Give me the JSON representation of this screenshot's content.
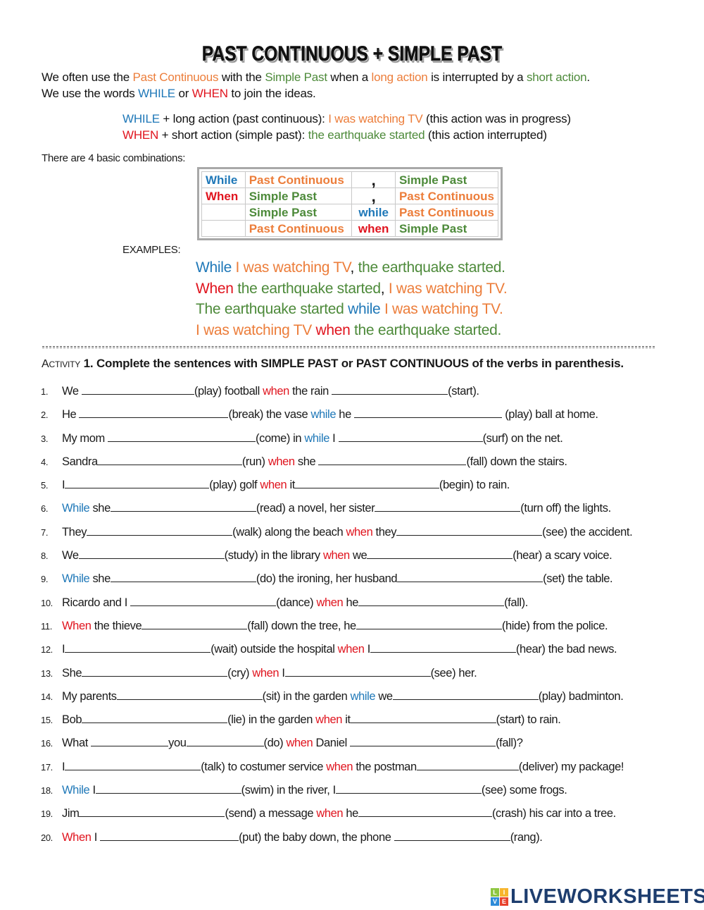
{
  "colors": {
    "blue": "#1f78b8",
    "red": "#e0141e",
    "orange": "#ec7d3a",
    "green": "#4d8a3a",
    "brand_navy": "#1d3d6e"
  },
  "title": "PAST CONTINUOUS + SIMPLE PAST",
  "intro": {
    "line1": [
      {
        "text": "We often use the ",
        "color": "black"
      },
      {
        "text": "Past Continuous",
        "color": "orange"
      },
      {
        "text": " with the ",
        "color": "black"
      },
      {
        "text": "Simple Past",
        "color": "green"
      },
      {
        "text": " when a ",
        "color": "black"
      },
      {
        "text": "long action",
        "color": "orange"
      },
      {
        "text": " is interrupted by a ",
        "color": "black"
      },
      {
        "text": "short action",
        "color": "green"
      },
      {
        "text": ".",
        "color": "black"
      }
    ],
    "line2": [
      {
        "text": "We use the words ",
        "color": "black"
      },
      {
        "text": "WHILE",
        "color": "blue"
      },
      {
        "text": " or ",
        "color": "black"
      },
      {
        "text": "WHEN",
        "color": "red"
      },
      {
        "text": " to join the ideas.",
        "color": "black"
      }
    ]
  },
  "rules": [
    [
      {
        "text": "WHILE",
        "color": "blue"
      },
      {
        "text": " + long action (past continuous): ",
        "color": "black"
      },
      {
        "text": "I was watching TV",
        "color": "orange"
      },
      {
        "text": " (this action was in progress)",
        "color": "black"
      }
    ],
    [
      {
        "text": "WHEN",
        "color": "red"
      },
      {
        "text": " + short action (simple past): ",
        "color": "black"
      },
      {
        "text": "the earthquake started",
        "color": "green"
      },
      {
        "text": " (this action interrupted)",
        "color": "black"
      }
    ]
  ],
  "combinations_label": "There are 4 basic combinations:",
  "combinations_table": [
    [
      {
        "text": "While",
        "color": "blue"
      },
      {
        "text": "Past Continuous",
        "color": "orange"
      },
      {
        "text": ",",
        "color": "comma"
      },
      {
        "text": "Simple Past",
        "color": "green"
      }
    ],
    [
      {
        "text": "When",
        "color": "red"
      },
      {
        "text": "Simple Past",
        "color": "green"
      },
      {
        "text": ",",
        "color": "comma"
      },
      {
        "text": "Past Continuous",
        "color": "orange"
      }
    ],
    [
      {
        "text": "",
        "color": "black"
      },
      {
        "text": "Simple Past",
        "color": "green"
      },
      {
        "text": "while",
        "color": "blue"
      },
      {
        "text": "Past Continuous",
        "color": "orange"
      }
    ],
    [
      {
        "text": "",
        "color": "black"
      },
      {
        "text": "Past Continuous",
        "color": "orange"
      },
      {
        "text": "when",
        "color": "red"
      },
      {
        "text": "Simple Past",
        "color": "green"
      }
    ]
  ],
  "examples_label": "EXAMPLES:",
  "examples": [
    [
      {
        "text": "While",
        "color": "blue"
      },
      {
        "text": " I was watching TV",
        "color": "orange"
      },
      {
        "text": ",",
        "color": "black"
      },
      {
        "text": " the earthquake started.",
        "color": "green"
      }
    ],
    [
      {
        "text": "When",
        "color": "red"
      },
      {
        "text": " the earthquake started",
        "color": "green"
      },
      {
        "text": ",",
        "color": "black"
      },
      {
        "text": " I was watching TV.",
        "color": "orange"
      }
    ],
    [
      {
        "text": "The earthquake started ",
        "color": "green"
      },
      {
        "text": " while",
        "color": "blue"
      },
      {
        "text": " I was watching TV.",
        "color": "orange"
      }
    ],
    [
      {
        "text": "I was watching TV",
        "color": "orange"
      },
      {
        "text": " when",
        "color": "red"
      },
      {
        "text": " the earthquake started.",
        "color": "green"
      }
    ]
  ],
  "activity": {
    "label_small": "Activity",
    "number": "1.",
    "instruction": "Complete the sentences with SIMPLE PAST or PAST CONTINUOUS of the verbs in parenthesis."
  },
  "exercises": [
    {
      "num": "1.",
      "parts": [
        {
          "t": "We "
        },
        {
          "b": 160
        },
        {
          "t": "(play) football "
        },
        {
          "t": "when",
          "c": "red"
        },
        {
          "t": " the rain "
        },
        {
          "b": 165
        },
        {
          "t": "(start)."
        }
      ]
    },
    {
      "num": "2.",
      "parts": [
        {
          "t": "He "
        },
        {
          "b": 212
        },
        {
          "t": "(break) the vase "
        },
        {
          "t": "while",
          "c": "blue"
        },
        {
          "t": " he "
        },
        {
          "b": 210
        },
        {
          "t": " (play) ball at home."
        }
      ]
    },
    {
      "num": "3.",
      "parts": [
        {
          "t": "My mom "
        },
        {
          "b": 210
        },
        {
          "t": "(come) in "
        },
        {
          "t": "while",
          "c": "blue"
        },
        {
          "t": " I "
        },
        {
          "b": 205
        },
        {
          "t": "(surf) on the net."
        }
      ]
    },
    {
      "num": "4.",
      "parts": [
        {
          "t": "Sandra"
        },
        {
          "b": 205
        },
        {
          "t": "(run) "
        },
        {
          "t": "when",
          "c": "red"
        },
        {
          "t": " she "
        },
        {
          "b": 210
        },
        {
          "t": "(fall) down the stairs."
        }
      ]
    },
    {
      "num": "5.",
      "parts": [
        {
          "t": "I"
        },
        {
          "b": 205
        },
        {
          "t": "(play) golf "
        },
        {
          "t": "when",
          "c": "red"
        },
        {
          "t": " it"
        },
        {
          "b": 205
        },
        {
          "t": "(begin) to rain."
        }
      ]
    },
    {
      "num": "6.",
      "parts": [
        {
          "t": "While",
          "c": "blue"
        },
        {
          "t": " she"
        },
        {
          "b": 207
        },
        {
          "t": "(read) a novel, her sister"
        },
        {
          "b": 207
        },
        {
          "t": "(turn off) the lights."
        }
      ]
    },
    {
      "num": "7.",
      "parts": [
        {
          "t": "They"
        },
        {
          "b": 207
        },
        {
          "t": "(walk) along the beach "
        },
        {
          "t": "when",
          "c": "red"
        },
        {
          "t": " they"
        },
        {
          "b": 207
        },
        {
          "t": "(see) the accident."
        }
      ]
    },
    {
      "num": "8.",
      "parts": [
        {
          "t": "We"
        },
        {
          "b": 207
        },
        {
          "t": "(study) in the library "
        },
        {
          "t": "when",
          "c": "red"
        },
        {
          "t": " we"
        },
        {
          "b": 207
        },
        {
          "t": "(hear) a scary voice."
        }
      ]
    },
    {
      "num": "9.",
      "parts": [
        {
          "t": "While",
          "c": "blue"
        },
        {
          "t": " she"
        },
        {
          "b": 207
        },
        {
          "t": "(do) the ironing, her husband"
        },
        {
          "b": 207
        },
        {
          "t": "(set) the table."
        }
      ]
    },
    {
      "num": "10.",
      "parts": [
        {
          "t": "Ricardo and I "
        },
        {
          "b": 207
        },
        {
          "t": "(dance) "
        },
        {
          "t": "when",
          "c": "red"
        },
        {
          "t": " he"
        },
        {
          "b": 207
        },
        {
          "t": "(fall)."
        }
      ]
    },
    {
      "num": "11.",
      "parts": [
        {
          "t": "When",
          "c": "red"
        },
        {
          "t": " the thieve"
        },
        {
          "b": 150
        },
        {
          "t": "(fall) down the tree, he"
        },
        {
          "b": 207
        },
        {
          "t": "(hide) from the police."
        }
      ]
    },
    {
      "num": "12.",
      "parts": [
        {
          "t": "I"
        },
        {
          "b": 207
        },
        {
          "t": "(wait) outside the hospital "
        },
        {
          "t": "when",
          "c": "red"
        },
        {
          "t": " I"
        },
        {
          "b": 207
        },
        {
          "t": "(hear) the bad news."
        }
      ]
    },
    {
      "num": "13.",
      "parts": [
        {
          "t": "She"
        },
        {
          "b": 207
        },
        {
          "t": "(cry) "
        },
        {
          "t": "when",
          "c": "red"
        },
        {
          "t": " I"
        },
        {
          "b": 207
        },
        {
          "t": "(see) her."
        }
      ]
    },
    {
      "num": "14.",
      "parts": [
        {
          "t": "My parents"
        },
        {
          "b": 207
        },
        {
          "t": "(sit) in the garden "
        },
        {
          "t": "while",
          "c": "blue"
        },
        {
          "t": " we"
        },
        {
          "b": 207
        },
        {
          "t": "(play) badminton."
        }
      ]
    },
    {
      "num": "15.",
      "parts": [
        {
          "t": "Bob"
        },
        {
          "b": 207
        },
        {
          "t": "(lie) in the garden "
        },
        {
          "t": "when",
          "c": "red"
        },
        {
          "t": " it"
        },
        {
          "b": 207
        },
        {
          "t": "(start) to rain."
        }
      ]
    },
    {
      "num": "16.",
      "parts": [
        {
          "t": "What "
        },
        {
          "b": 110
        },
        {
          "t": "you"
        },
        {
          "b": 110
        },
        {
          "t": "(do) "
        },
        {
          "t": "when",
          "c": "red"
        },
        {
          "t": " Daniel "
        },
        {
          "b": 207
        },
        {
          "t": "(fall)?"
        }
      ]
    },
    {
      "num": "17.",
      "parts": [
        {
          "t": "I"
        },
        {
          "b": 193
        },
        {
          "t": "(talk) to costumer service "
        },
        {
          "t": "when",
          "c": "red"
        },
        {
          "t": " the postman"
        },
        {
          "b": 145
        },
        {
          "t": "(deliver) my package!"
        }
      ]
    },
    {
      "num": "18.",
      "parts": [
        {
          "t": "While",
          "c": "blue"
        },
        {
          "t": " I"
        },
        {
          "b": 207
        },
        {
          "t": "(swim) in the river, I"
        },
        {
          "b": 207
        },
        {
          "t": "(see) some frogs."
        }
      ]
    },
    {
      "num": "19.",
      "parts": [
        {
          "t": "Jim"
        },
        {
          "b": 207
        },
        {
          "t": "(send) a message "
        },
        {
          "t": "when",
          "c": "red"
        },
        {
          "t": " he"
        },
        {
          "b": 190
        },
        {
          "t": "(crash) his car into a tree."
        }
      ]
    },
    {
      "num": "20.",
      "parts": [
        {
          "t": "When",
          "c": "red"
        },
        {
          "t": " I "
        },
        {
          "b": 197
        },
        {
          "t": "(put) the baby down, the phone "
        },
        {
          "b": 165
        },
        {
          "t": "(rang)."
        }
      ]
    }
  ],
  "logo": {
    "squares": [
      {
        "letter": "L",
        "color": "#8dc63f"
      },
      {
        "letter": "I",
        "color": "#f7b52c"
      },
      {
        "letter": "V",
        "color": "#2e8bd8"
      },
      {
        "letter": "E",
        "color": "#e8412c"
      }
    ],
    "text": "LIVEWORKSHEETS"
  }
}
